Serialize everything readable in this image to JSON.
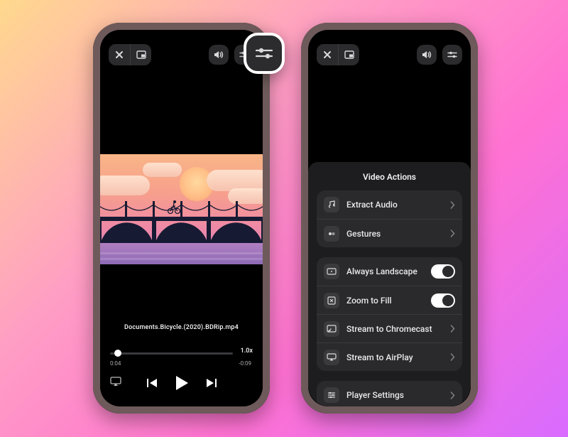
{
  "player": {
    "filename": "Documents.Bicycle.(2020).BDRip.mp4",
    "elapsed": "0:04",
    "remaining": "-0:09",
    "speed": "1.0x"
  },
  "menu": {
    "title": "Video Actions",
    "extract_audio": "Extract Audio",
    "gestures": "Gestures",
    "always_landscape": "Always Landscape",
    "zoom_to_fill": "Zoom to Fill",
    "stream_chromecast": "Stream to Chromecast",
    "stream_airplay": "Stream to AirPlay",
    "player_settings": "Player Settings"
  }
}
